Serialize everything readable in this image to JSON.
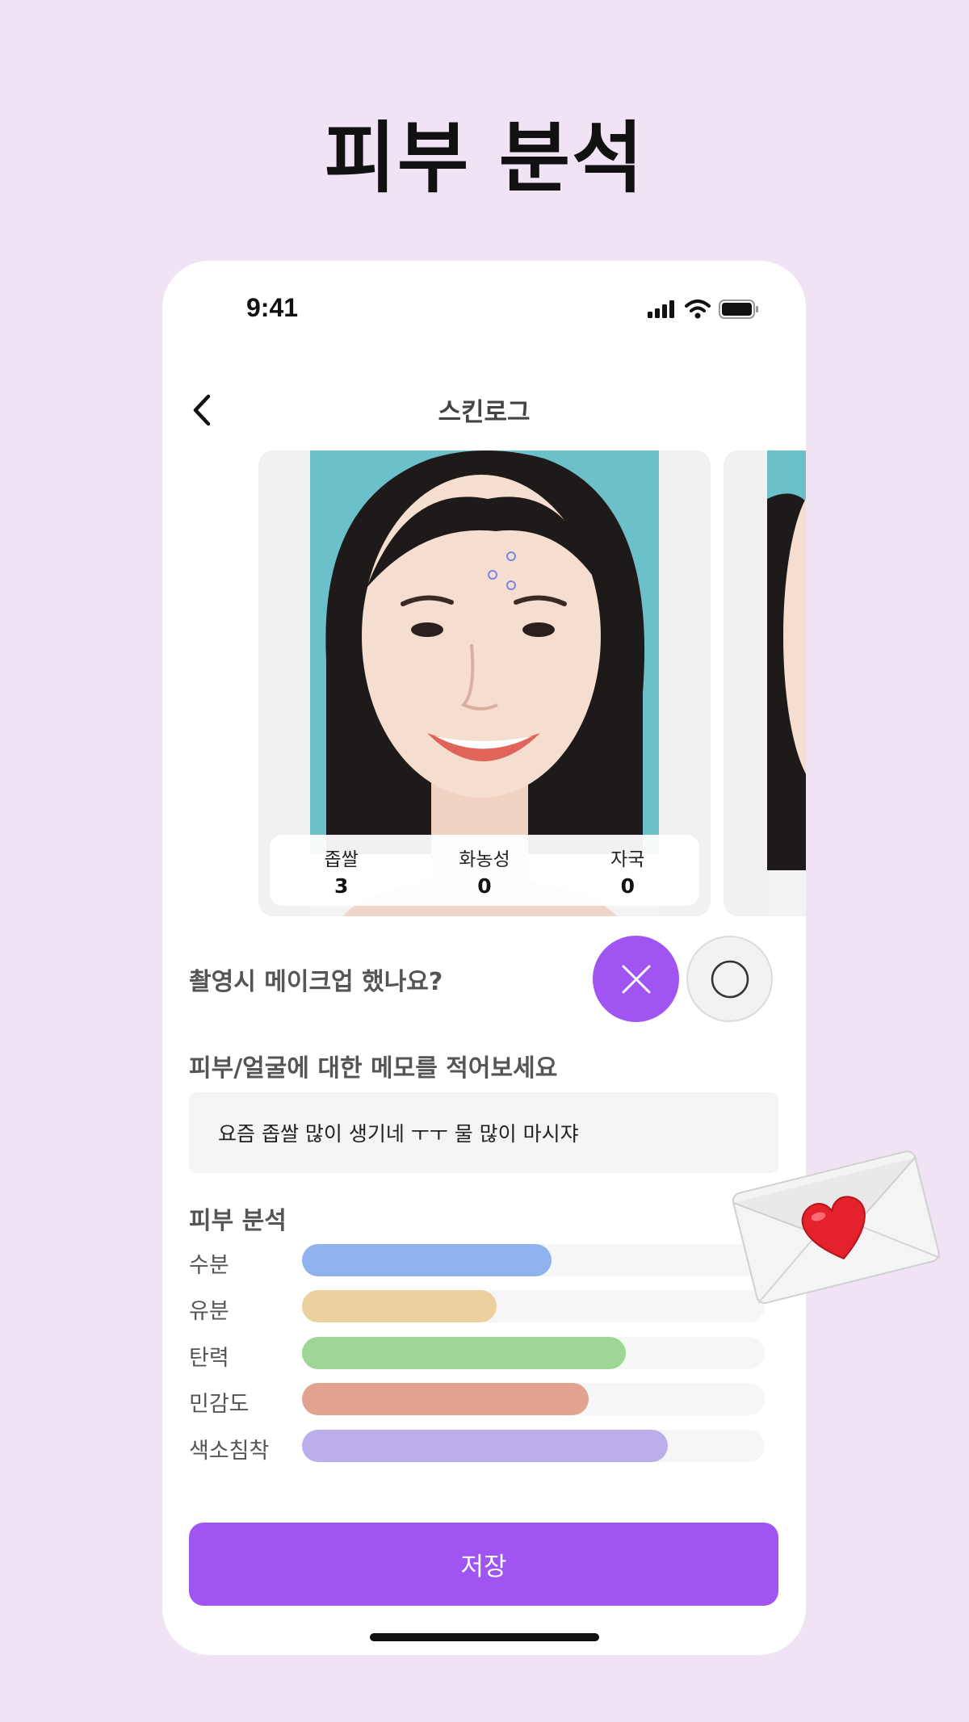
{
  "page": {
    "title": "피부 분석"
  },
  "status_bar": {
    "time": "9:41"
  },
  "nav": {
    "title": "스킨로그"
  },
  "photo_stats": [
    {
      "label": "좁쌀",
      "value": "3"
    },
    {
      "label": "화농성",
      "value": "0"
    },
    {
      "label": "자국",
      "value": "0"
    }
  ],
  "makeup": {
    "question": "촬영시 메이크업 했나요?",
    "selected": "x"
  },
  "memo": {
    "label": "피부/얼굴에 대한 메모를 적어보세요",
    "value": "요즘 좁쌀 많이 생기네 ㅜㅜ 물 많이 마시쟈"
  },
  "analysis": {
    "title": "피부 분석",
    "metrics": [
      {
        "label": "수분",
        "level": 0.54,
        "color": "#8fb2ef"
      },
      {
        "label": "유분",
        "level": 0.42,
        "color": "#ecd09e"
      },
      {
        "label": "탄력",
        "level": 0.7,
        "color": "#9ed795"
      },
      {
        "label": "민감도",
        "level": 0.62,
        "color": "#e2a290"
      },
      {
        "label": "색소침착",
        "level": 0.79,
        "color": "#bcaeea"
      }
    ]
  },
  "save_button": {
    "label": "저장"
  },
  "colors": {
    "accent": "#a055f2",
    "background": "#efe3f4"
  },
  "icons": [
    "back-chevron-icon",
    "signal-icon",
    "wifi-icon",
    "battery-icon",
    "x-icon",
    "circle-icon",
    "love-letter-icon"
  ]
}
